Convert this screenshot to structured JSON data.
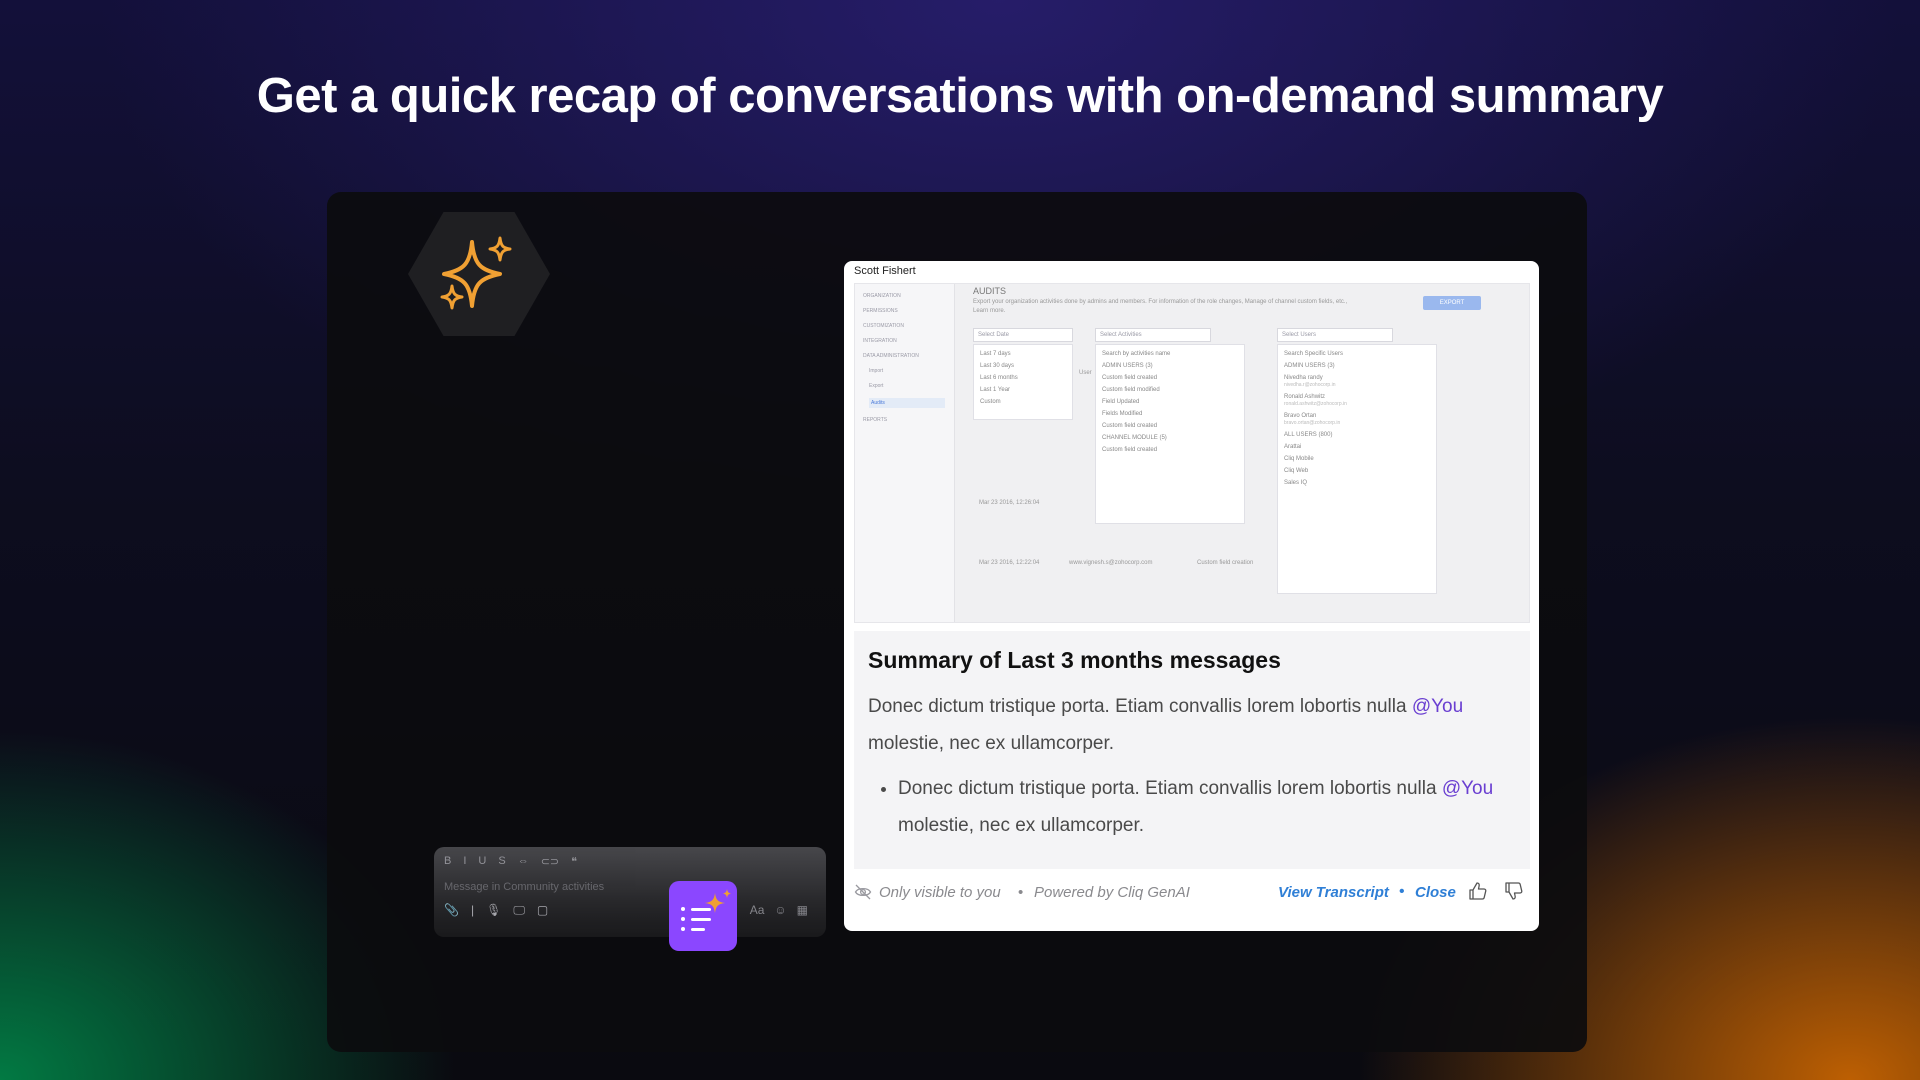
{
  "headline": "Get a quick recap of conversations with on-demand summary",
  "colors": {
    "accent_purple": "#8b47ff",
    "link_blue": "#2f7fd6",
    "mention": "#6a3fd1",
    "sparkle": "#f0a033"
  },
  "icons": [
    "sparkle-icon",
    "play-icon",
    "eye-off-icon",
    "thumbs-up-icon",
    "thumbs-down-icon",
    "summary-sparkle-icon"
  ],
  "composer": {
    "format_icons": [
      "B",
      "I",
      "U",
      "S",
      "⇔",
      "⊂⊃",
      "❝"
    ],
    "placeholder": "Message in Community activities",
    "tools": [
      "📎",
      "|",
      "🎙",
      "🖵",
      "▢"
    ],
    "tools_right": [
      "Aa",
      "☺",
      "▦"
    ]
  },
  "card": {
    "sender": "Scott Fishert",
    "preview": {
      "sidebar": [
        "ORGANIZATION",
        "PERMISSIONS",
        "CUSTOMIZATION",
        "INTEGRATION",
        "DATA ADMINISTRATION",
        "Import",
        "Export",
        "Audits",
        "REPORTS"
      ],
      "title": "AUDITS",
      "description": "Export your organization activities done by admins and members. For information of the role changes, Manage of channel custom fields, etc., Learn more.",
      "export_label": "EXPORT",
      "select_date": "Select Date",
      "select_activities": "Select Activities",
      "select_users": "Select Users",
      "date_options": [
        "Last 7 days",
        "Last 30 days",
        "Last 6 months",
        "Last 1 Year",
        "Custom"
      ],
      "activity_search": "Search by activities name",
      "admin_users": "ADMIN USERS (3)",
      "activities": [
        "Custom field created",
        "Custom field modified",
        "Field Updated",
        "Fields Modified",
        "Custom field created"
      ],
      "channel_module": "CHANNEL MODULE (5)",
      "channel_activity": "Custom field created",
      "user_search": "Search Specific Users",
      "users_admin": "ADMIN USERS (3)",
      "users": [
        {
          "name": "Nivedha randy",
          "email": "nivedha.r@zohocorp.in"
        },
        {
          "name": "Ronald Ashwitz",
          "email": "ronald.ashwitz@zohocorp.in"
        },
        {
          "name": "Bravo Ortan",
          "email": "bravo.ortan@zohocorp.in"
        }
      ],
      "all_users": "ALL USERS (800)",
      "bots": [
        "Arattai",
        "Cliq Mobile",
        "Cliq Web",
        "Sales IQ"
      ],
      "rows": [
        {
          "date": "Mar 23 2016, 12:26:04",
          "user": "",
          "action": ""
        },
        {
          "date": "Mar 23 2016, 12:22:04",
          "user": "www.vignesh.s@zohocorp.com",
          "action": "Custom field creation"
        }
      ],
      "users_label": "User"
    },
    "summary_title": "Summary of Last 3 months messages",
    "paragraph_text": "Donec dictum tristique porta. Etiam convallis lorem lobortis nulla",
    "mention": "@You",
    "paragraph_tail": "molestie, nec  ex ullamcorper.",
    "bullet_text": "Donec dictum tristique porta. Etiam convallis lorem lobortis nulla",
    "bullet_tail": "molestie, nec  ex ullamcorper.",
    "footer": {
      "visibility": "Only visible to you",
      "separator": "•",
      "powered_by": "Powered by Cliq GenAI",
      "view_transcript": "View Transcript",
      "close": "Close"
    }
  }
}
